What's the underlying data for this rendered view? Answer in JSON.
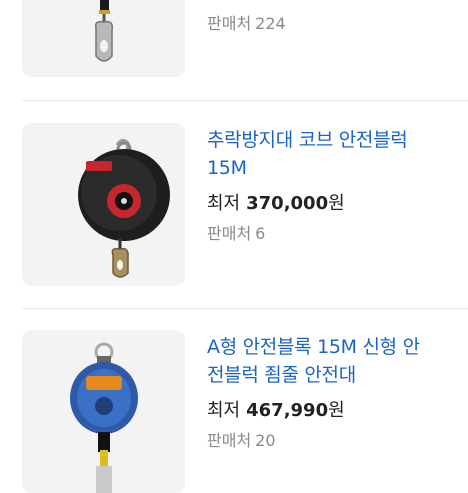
{
  "items": [
    {
      "title_lines": [],
      "price_label": "",
      "price": "",
      "currency": "",
      "sellers_label": "판매처",
      "sellers_count": "224",
      "image_icon": "hook-lanyard-icon"
    },
    {
      "title_lines": [
        "추락방지대 코브 안전블럭",
        "15M"
      ],
      "price_label": "최저",
      "price": "370,000",
      "currency": "원",
      "sellers_label": "판매처",
      "sellers_count": "6",
      "image_icon": "fall-arrester-black-icon"
    },
    {
      "title_lines": [
        "A형 안전블록 15M 신형 안",
        "전블럭 죔줄 안전대"
      ],
      "price_label": "최저",
      "price": "467,990",
      "currency": "원",
      "sellers_label": "판매처",
      "sellers_count": "20",
      "image_icon": "fall-arrester-blue-icon"
    }
  ]
}
